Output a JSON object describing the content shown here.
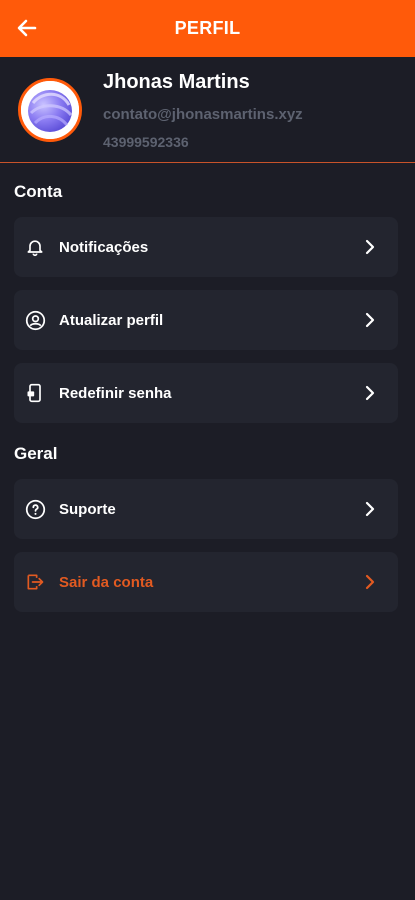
{
  "header": {
    "title": "PERFIL",
    "back_icon": "arrow-left-icon",
    "background": "#ff5a0a"
  },
  "profile": {
    "name": "Jhonas Martins",
    "email": "contato@jhonasmartins.xyz",
    "phone": "43999592336"
  },
  "sections": {
    "account": {
      "title": "Conta",
      "items": [
        {
          "label": "Notificações",
          "icon": "bell-icon"
        },
        {
          "label": "Atualizar perfil",
          "icon": "user-circle-icon"
        },
        {
          "label": "Redefinir senha",
          "icon": "phone-lock-icon"
        }
      ]
    },
    "general": {
      "title": "Geral",
      "items": [
        {
          "label": "Suporte",
          "icon": "help-circle-icon"
        },
        {
          "label": "Sair da conta",
          "icon": "logout-icon",
          "color": "#e25a21"
        }
      ]
    }
  },
  "colors": {
    "accent": "#ff5a0a",
    "background": "#1c1d26",
    "card": "#23252f",
    "muted_text": "#5d6270",
    "danger_text": "#e25a21"
  }
}
